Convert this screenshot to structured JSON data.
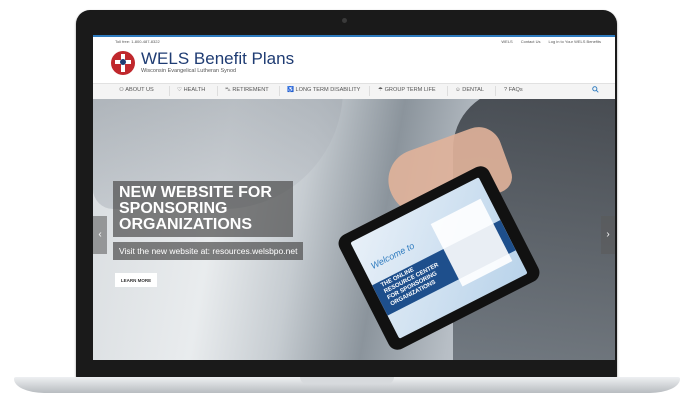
{
  "topbar": {
    "tollfree": "Toll free: 1-800-487-8322",
    "links": [
      "WELS",
      "Contact Us",
      "Log in to Your WELS Benefits"
    ]
  },
  "header": {
    "brand": "WELS Benefit Plans",
    "tagline": "Wisconsin Evangelical Lutheran Synod"
  },
  "nav": {
    "items": [
      {
        "icon": "people-icon",
        "glyph": "⚇",
        "label": "ABOUT US"
      },
      {
        "icon": "heart-icon",
        "glyph": "♡",
        "label": "HEALTH"
      },
      {
        "icon": "car-icon",
        "glyph": "⛍",
        "label": "RETIREMENT"
      },
      {
        "icon": "wheelchair-icon",
        "glyph": "♿",
        "label": "LONG TERM DISABILITY"
      },
      {
        "icon": "umbrella-icon",
        "glyph": "☂",
        "label": "GROUP TERM LIFE"
      },
      {
        "icon": "smile-icon",
        "glyph": "☺",
        "label": "DENTAL"
      },
      {
        "icon": "question-icon",
        "glyph": "?",
        "label": "FAQs"
      }
    ],
    "search_icon": "search-icon"
  },
  "hero": {
    "title": "NEW WEBSITE FOR SPONSORING ORGANIZATIONS",
    "subtitle": "Visit the new website at: resources.welsbpo.net",
    "button": "LEARN MORE",
    "tablet_welcome": "Welcome to",
    "tablet_title": "THE ONLINE RESOURCE CENTER FOR SPONSORING ORGANIZATIONS"
  },
  "colors": {
    "accent": "#2e7bbf",
    "brand": "#1f3c73",
    "logo": "#c0282d"
  }
}
